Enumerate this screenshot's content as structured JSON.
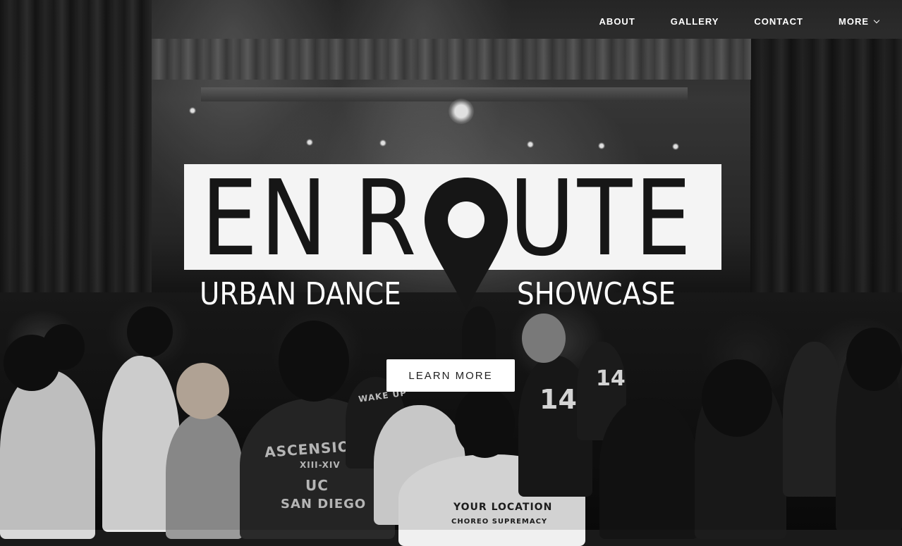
{
  "nav": {
    "items": [
      {
        "label": "ABOUT"
      },
      {
        "label": "GALLERY"
      },
      {
        "label": "CONTACT"
      },
      {
        "label": "MORE"
      }
    ],
    "more_icon": "chevron-down-icon"
  },
  "hero": {
    "logo": {
      "word_en": "EN",
      "word_r": "R",
      "word_ute": "UTE",
      "subtitle_left": "URBAN DANCE",
      "subtitle_right": "SHOWCASE",
      "pin_icon": "map-pin-icon"
    },
    "cta_label": "LEARN MORE",
    "crowd_text": {
      "shirt_back": "ASCENSION",
      "shirt_years": "XIII-XIV",
      "shirt_uc": "UC",
      "shirt_sd": "SAN DIEGO",
      "your_location": "YOUR LOCATION",
      "choreo": "CHOREO SUPREMACY",
      "wake_up": "WAKE UP",
      "jersey_left": "14",
      "jersey_right": "14"
    }
  },
  "colors": {
    "logo_background": "#f4f4f4",
    "logo_text": "#161616",
    "nav_text": "#ffffff",
    "cta_background": "#ffffff",
    "cta_text": "#222222"
  }
}
